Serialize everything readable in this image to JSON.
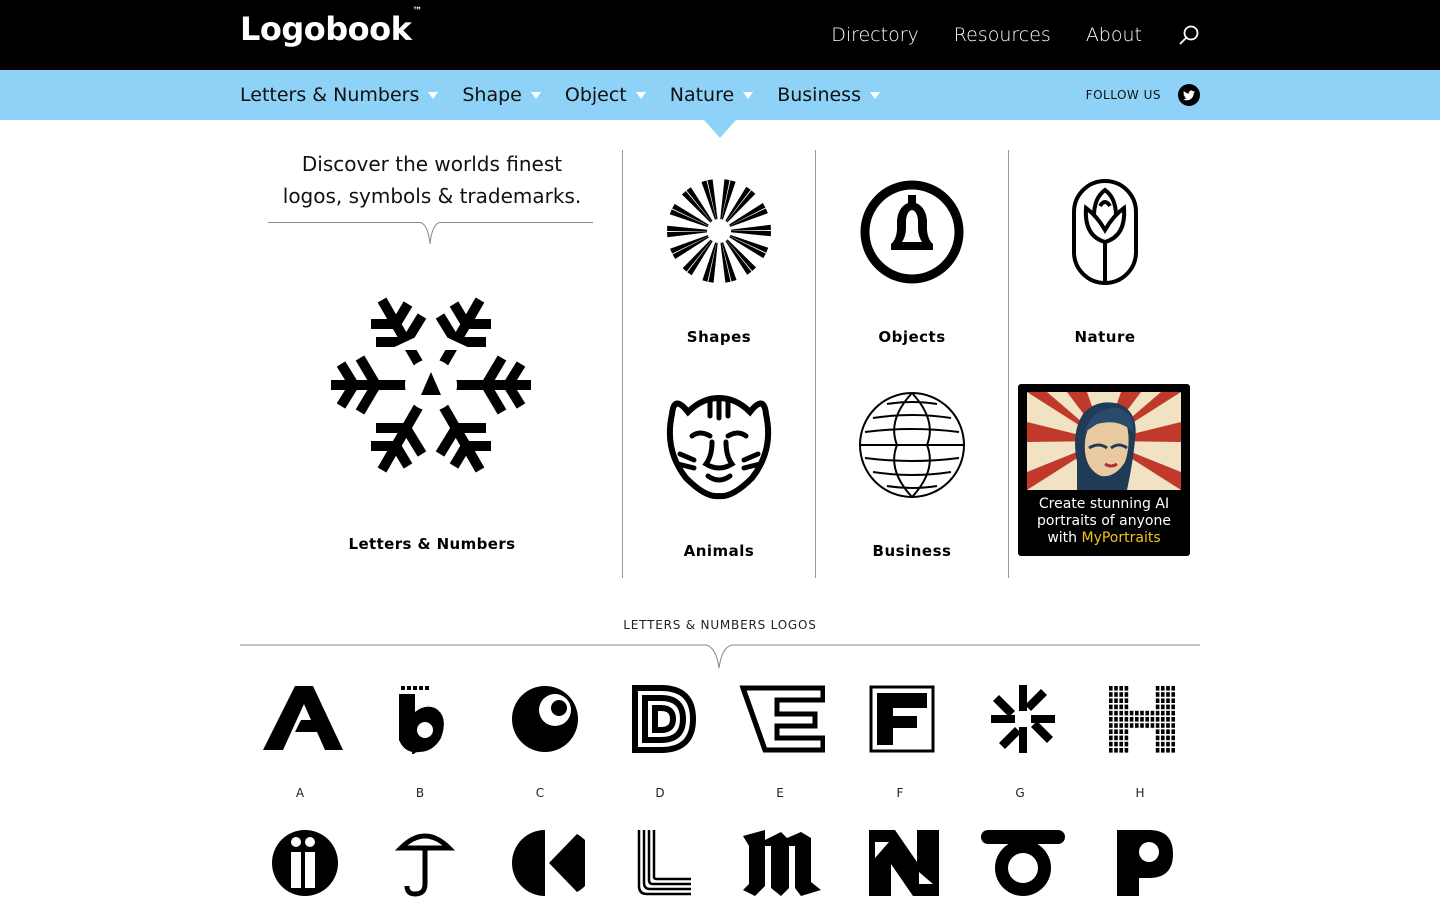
{
  "header": {
    "logo": "Logobook",
    "tm": "™",
    "nav": [
      "Directory",
      "Resources",
      "About"
    ]
  },
  "catbar": {
    "items": [
      "Letters & Numbers",
      "Shape",
      "Object",
      "Nature",
      "Business"
    ],
    "follow_label": "FOLLOW US"
  },
  "hero": {
    "tagline_1": "Discover the worlds finest",
    "tagline_2": "logos, symbols & trademarks.",
    "feature_label": "Letters & Numbers"
  },
  "tiles": {
    "shapes": "Shapes",
    "objects": "Objects",
    "nature": "Nature",
    "animals": "Animals",
    "business": "Business"
  },
  "ad": {
    "line1": "Create stunning AI",
    "line2": "portraits of anyone",
    "line3_prefix": "with ",
    "brand": "MyPortraits"
  },
  "section": {
    "title": "LETTERS & NUMBERS LOGOS",
    "row1": [
      "A",
      "B",
      "C",
      "D",
      "E",
      "F",
      "G",
      "H"
    ]
  },
  "colors": {
    "topbar": "#000000",
    "catbar": "#8fd2f7",
    "ad_brand": "#f0c419"
  }
}
